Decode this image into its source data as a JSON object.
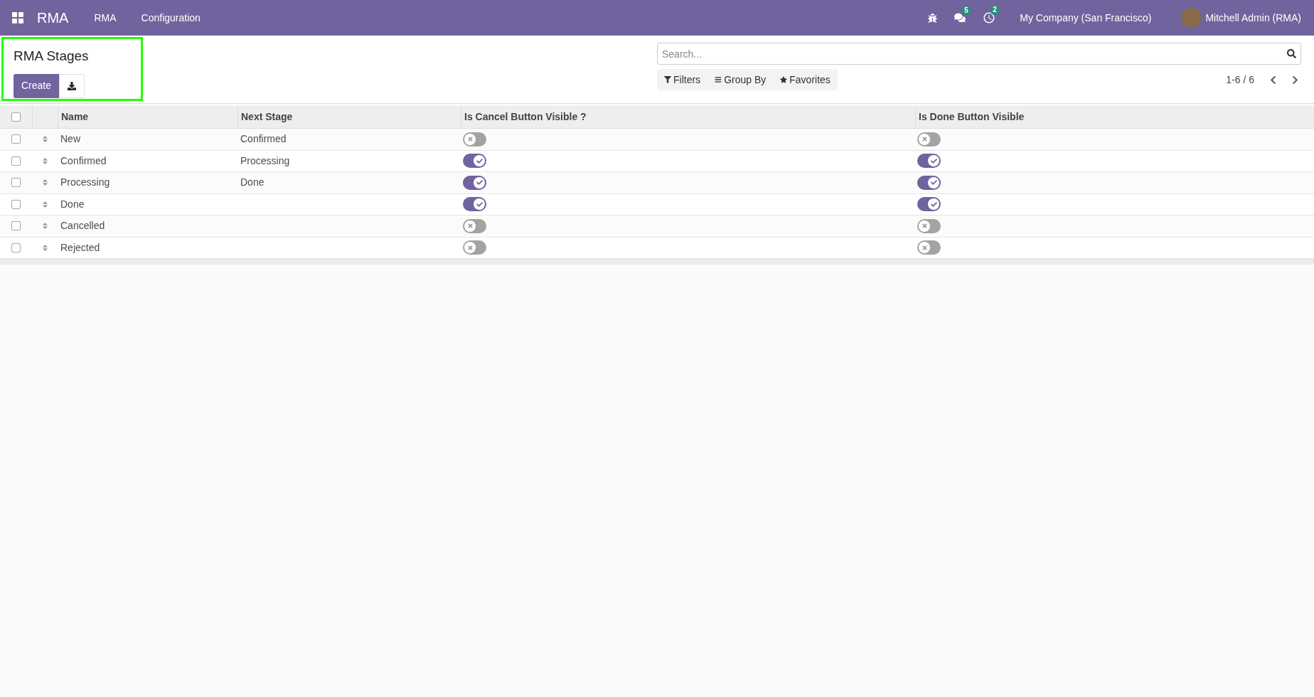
{
  "navbar": {
    "app_name": "RMA",
    "menu": [
      "RMA",
      "Configuration"
    ],
    "chat_count": "5",
    "activity_count": "2",
    "company": "My Company (San Francisco)",
    "user": "Mitchell Admin (RMA)"
  },
  "control_panel": {
    "title": "RMA Stages",
    "create_label": "Create",
    "search": {
      "placeholder": "Search..."
    },
    "filters": [
      "Filters",
      "Group By",
      "Favorites"
    ],
    "pager": "1-6 / 6"
  },
  "table": {
    "all_checked": false,
    "columns": [
      "Name",
      "Next Stage",
      "Is Cancel Button Visible ?",
      "Is Done Button Visible"
    ],
    "rows": [
      {
        "checked": false,
        "name": "New",
        "next_stage": "Confirmed",
        "cancel_visible": false,
        "done_visible": false
      },
      {
        "checked": false,
        "name": "Confirmed",
        "next_stage": "Processing",
        "cancel_visible": true,
        "done_visible": true
      },
      {
        "checked": false,
        "name": "Processing",
        "next_stage": "Done",
        "cancel_visible": true,
        "done_visible": true
      },
      {
        "checked": false,
        "name": "Done",
        "next_stage": "",
        "cancel_visible": true,
        "done_visible": true
      },
      {
        "checked": false,
        "name": "Cancelled",
        "next_stage": "",
        "cancel_visible": false,
        "done_visible": false
      },
      {
        "checked": false,
        "name": "Rejected",
        "next_stage": "",
        "cancel_visible": false,
        "done_visible": false
      }
    ]
  }
}
